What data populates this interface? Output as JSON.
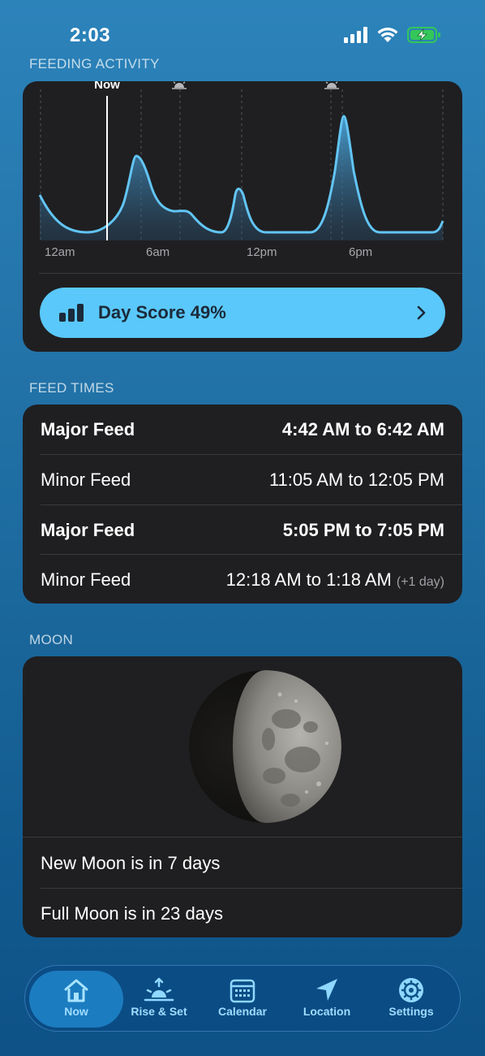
{
  "status": {
    "time": "2:03"
  },
  "feeding_activity": {
    "title": "FEEDING ACTIVITY",
    "now_label": "Now",
    "axis_labels": [
      "12am",
      "6am",
      "12pm",
      "6pm"
    ],
    "day_score_label": "Day Score 49%"
  },
  "feed_times": {
    "title": "FEED TIMES",
    "rows": [
      {
        "name": "Major Feed",
        "time": "4:42 AM to 6:42 AM",
        "suffix": ""
      },
      {
        "name": "Minor Feed",
        "time": "11:05 AM to 12:05 PM",
        "suffix": ""
      },
      {
        "name": "Major Feed",
        "time": "5:05 PM to 7:05 PM",
        "suffix": ""
      },
      {
        "name": "Minor Feed",
        "time": "12:18 AM to 1:18 AM",
        "suffix": "(+1 day)"
      }
    ]
  },
  "moon": {
    "title": "MOON",
    "new_moon": "New Moon is in 7 days",
    "full_moon": "Full Moon is in 23 days"
  },
  "tabs": [
    {
      "label": "Now",
      "icon": "house-icon",
      "active": true
    },
    {
      "label": "Rise & Set",
      "icon": "sunrise-icon",
      "active": false
    },
    {
      "label": "Calendar",
      "icon": "calendar-icon",
      "active": false
    },
    {
      "label": "Location",
      "icon": "location-arrow-icon",
      "active": false
    },
    {
      "label": "Settings",
      "icon": "gear-icon",
      "active": false
    }
  ],
  "colors": {
    "accent": "#5ac8fa",
    "card": "#1f1f21",
    "tab_active": "#1c7cc0"
  }
}
